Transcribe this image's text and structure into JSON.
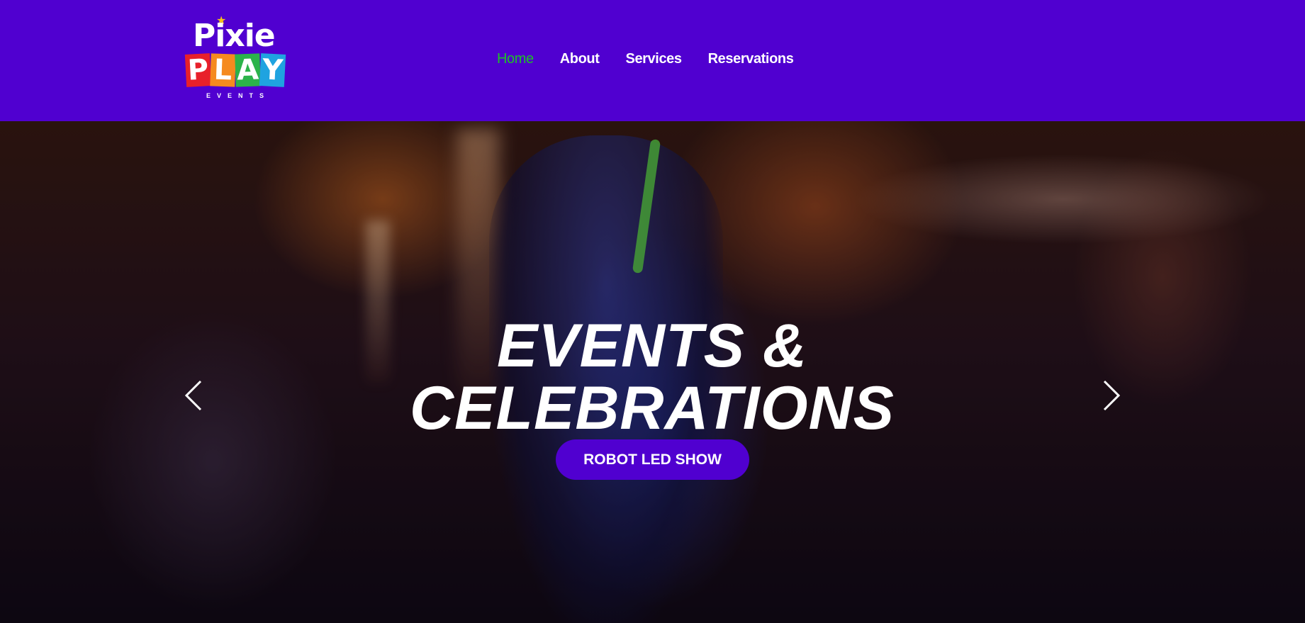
{
  "header": {
    "logo": {
      "line1": "Pixie",
      "line2_letters": [
        "P",
        "L",
        "A",
        "Y"
      ],
      "line3": "EVENTS",
      "colors": [
        "#e8202a",
        "#f58a1f",
        "#2cb34a",
        "#1fa3e0"
      ],
      "star_color": "#f7c21a"
    },
    "nav": [
      {
        "label": "Home",
        "active": true
      },
      {
        "label": "About",
        "active": false
      },
      {
        "label": "Services",
        "active": false
      },
      {
        "label": "Reservations",
        "active": false
      }
    ],
    "background_color": "#5000d0",
    "active_color": "#1fbf2a"
  },
  "hero": {
    "title_line1": "EVENTS &",
    "title_line2": "CELEBRATIONS",
    "cta_label": "ROBOT LED SHOW",
    "prev_icon": "chevron-left-icon",
    "next_icon": "chevron-right-icon"
  }
}
